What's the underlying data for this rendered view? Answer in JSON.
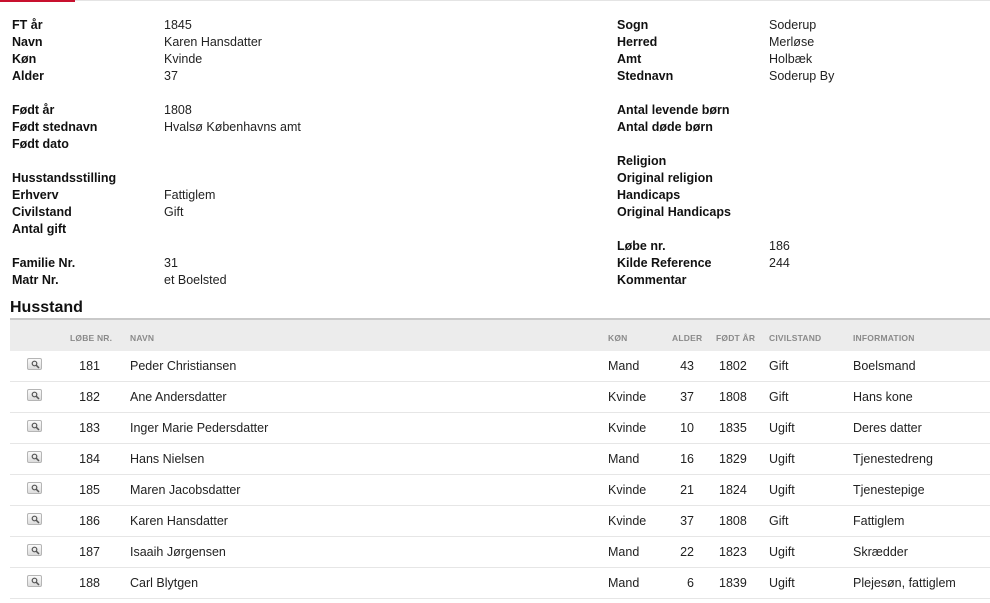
{
  "colors": {
    "accent": "#c8102e",
    "header_bg": "#ececec",
    "row_border": "#e6e6e6"
  },
  "left_fields": [
    {
      "label": "FT år",
      "value": "1845"
    },
    {
      "label": "Navn",
      "value": "Karen Hansdatter"
    },
    {
      "label": "Køn",
      "value": "Kvinde"
    },
    {
      "label": "Alder",
      "value": "37"
    },
    {
      "label": "",
      "value": ""
    },
    {
      "label": "Født år",
      "value": "1808"
    },
    {
      "label": "Født stednavn",
      "value": "Hvalsø Københavns amt"
    },
    {
      "label": "Født dato",
      "value": ""
    },
    {
      "label": "",
      "value": ""
    },
    {
      "label": "Husstandsstilling",
      "value": ""
    },
    {
      "label": "Erhverv",
      "value": "Fattiglem"
    },
    {
      "label": "Civilstand",
      "value": "Gift"
    },
    {
      "label": "Antal gift",
      "value": ""
    },
    {
      "label": "",
      "value": ""
    },
    {
      "label": "Familie Nr.",
      "value": "31"
    },
    {
      "label": "Matr Nr.",
      "value": "et Boelsted"
    }
  ],
  "right_fields": [
    {
      "label": "Sogn",
      "value": "Soderup"
    },
    {
      "label": "Herred",
      "value": "Merløse"
    },
    {
      "label": "Amt",
      "value": "Holbæk"
    },
    {
      "label": "Stednavn",
      "value": "Soderup By"
    },
    {
      "label": "",
      "value": ""
    },
    {
      "label": "Antal levende børn",
      "value": ""
    },
    {
      "label": "Antal døde børn",
      "value": ""
    },
    {
      "label": "",
      "value": ""
    },
    {
      "label": "Religion",
      "value": ""
    },
    {
      "label": "Original religion",
      "value": ""
    },
    {
      "label": "Handicaps",
      "value": ""
    },
    {
      "label": "Original Handicaps",
      "value": ""
    },
    {
      "label": "",
      "value": ""
    },
    {
      "label": "Løbe nr.",
      "value": "186"
    },
    {
      "label": "Kilde Reference",
      "value": "244"
    },
    {
      "label": "Kommentar",
      "value": ""
    }
  ],
  "household": {
    "title": "Husstand",
    "columns": {
      "lobe": "LØBE NR.",
      "navn": "NAVN",
      "kon": "KØN",
      "alder": "ALDER",
      "fodt": "FØDT ÅR",
      "civil": "CIVILSTAND",
      "info": "INFORMATION"
    },
    "rows": [
      {
        "icon": "magnifier-icon",
        "lobe": "181",
        "navn": "Peder Christiansen",
        "kon": "Mand",
        "alder": "43",
        "fodt": "1802",
        "civil": "Gift",
        "info": "Boelsmand"
      },
      {
        "icon": "magnifier-icon",
        "lobe": "182",
        "navn": "Ane Andersdatter",
        "kon": "Kvinde",
        "alder": "37",
        "fodt": "1808",
        "civil": "Gift",
        "info": "Hans kone"
      },
      {
        "icon": "magnifier-icon",
        "lobe": "183",
        "navn": "Inger Marie Pedersdatter",
        "kon": "Kvinde",
        "alder": "10",
        "fodt": "1835",
        "civil": "Ugift",
        "info": "Deres datter"
      },
      {
        "icon": "magnifier-icon",
        "lobe": "184",
        "navn": "Hans Nielsen",
        "kon": "Mand",
        "alder": "16",
        "fodt": "1829",
        "civil": "Ugift",
        "info": "Tjenestedreng"
      },
      {
        "icon": "magnifier-icon",
        "lobe": "185",
        "navn": "Maren Jacobsdatter",
        "kon": "Kvinde",
        "alder": "21",
        "fodt": "1824",
        "civil": "Ugift",
        "info": "Tjenestepige"
      },
      {
        "icon": "magnifier-icon",
        "lobe": "186",
        "navn": "Karen Hansdatter",
        "kon": "Kvinde",
        "alder": "37",
        "fodt": "1808",
        "civil": "Gift",
        "info": "Fattiglem"
      },
      {
        "icon": "magnifier-icon",
        "lobe": "187",
        "navn": "Isaaih Jørgensen",
        "kon": "Mand",
        "alder": "22",
        "fodt": "1823",
        "civil": "Ugift",
        "info": "Skrædder"
      },
      {
        "icon": "magnifier-icon",
        "lobe": "188",
        "navn": "Carl Blytgen",
        "kon": "Mand",
        "alder": "6",
        "fodt": "1839",
        "civil": "Ugift",
        "info": "Plejesøn, fattiglem"
      }
    ]
  }
}
